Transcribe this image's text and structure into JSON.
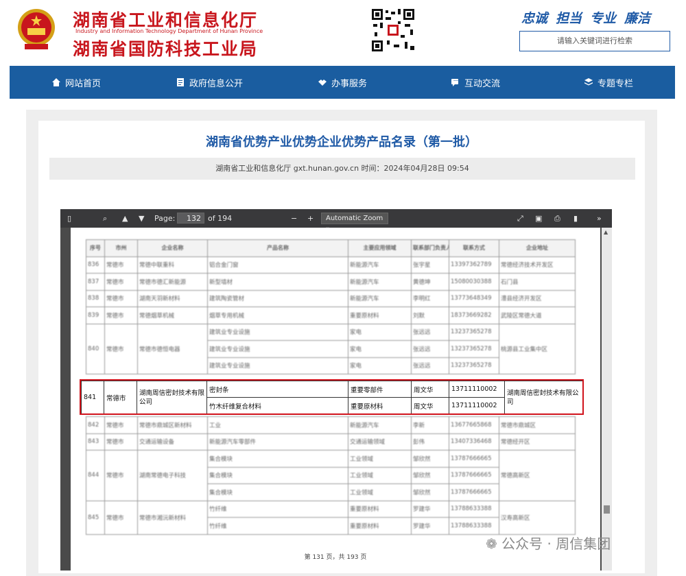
{
  "header": {
    "title_line1": "湖南省工业和信息化厅",
    "title_en": "Industry and Information Technology Department of Hunan Province",
    "title_line2": "湖南省国防科技工业局",
    "slogans": [
      "忠诚",
      "担当",
      "专业",
      "廉洁"
    ],
    "search_placeholder": "请输入关键词进行检索"
  },
  "nav": [
    {
      "label": "网站首页",
      "icon": "home-icon"
    },
    {
      "label": "政府信息公开",
      "icon": "document-icon"
    },
    {
      "label": "办事服务",
      "icon": "handshake-icon"
    },
    {
      "label": "互动交流",
      "icon": "chat-icon"
    },
    {
      "label": "专题专栏",
      "icon": "layers-icon"
    }
  ],
  "article": {
    "title": "湖南省优势产业优势企业优势产品名录（第一批）",
    "meta": "湖南省工业和信息化厅 gxt.hunan.gov.cn   时间：2024年04月28日 09:54"
  },
  "viewer": {
    "page_label": "Page:",
    "page_current": "132",
    "page_total": "of 194",
    "zoom": "Automatic Zoom",
    "page_footer": "第 131 页，共 193 页"
  },
  "table": {
    "headers": [
      "序号",
      "市州",
      "企业名称",
      "产品名称",
      "主要应用领域",
      "联系部门负责人",
      "联系方式",
      "企业地址"
    ],
    "rows_before": [
      {
        "no": "836",
        "city": "常德市",
        "company": "常德中联重科",
        "product": "铝合金门窗",
        "field": "新能源汽车",
        "person": "张宇星",
        "phone": "13397362789",
        "addr": "常德经济技术开发区"
      },
      {
        "no": "837",
        "city": "常德市",
        "company": "常德市德汇新能源",
        "product": "新型墙材",
        "field": "新能源汽车",
        "person": "黄德坤",
        "phone": "15080030388",
        "addr": "石门县"
      },
      {
        "no": "838",
        "city": "常德市",
        "company": "湖南天羽新材料",
        "product": "建筑陶瓷管材",
        "field": "新能源汽车",
        "person": "李明红",
        "phone": "13773648349",
        "addr": "澧县经济开发区"
      },
      {
        "no": "839",
        "city": "常德市",
        "company": "常德烟草机械",
        "product": "烟草专用机械",
        "field": "重要原材料",
        "person": "刘默",
        "phone": "18373669282",
        "addr": "武陵区常德大道"
      },
      {
        "no": "840",
        "city": "常德市",
        "company": "常德市德恒电器",
        "product": "建筑业专业设施",
        "field": "家电",
        "person": "张远远",
        "phone": "13237365278",
        "addr": "桃源县工业集中区"
      }
    ],
    "highlight": [
      {
        "no": "841",
        "city": "常德市",
        "company": "湖南周信密封技术有限公司",
        "product": "密封条",
        "field": "重要零部件",
        "person": "周文华",
        "phone": "13711110002",
        "addr": "湖南周信密封技术有限公司"
      },
      {
        "product": "竹木纤维复合材料",
        "field": "重要原材料",
        "person": "周文华",
        "phone": "13711110002"
      }
    ],
    "rows_after": [
      {
        "no": "842",
        "city": "常德市",
        "company": "常德市鼎城区新材料",
        "product": "工业",
        "field": "新能源汽车",
        "person": "李新",
        "phone": "13677665868",
        "addr": "常德市鼎城区"
      },
      {
        "no": "843",
        "city": "常德市",
        "company": "交通运输设备",
        "product": "新能源汽车零部件",
        "field": "交通运输领域",
        "person": "彭伟",
        "phone": "13407336468",
        "addr": "常德经开区"
      },
      {
        "no": "844",
        "city": "常德市",
        "company": "湖南常德电子科技",
        "product": "集合模块",
        "field": "工业领域",
        "person": "邹欣然",
        "phone": "13787666665",
        "addr": "常德高新区"
      },
      {
        "no": "845",
        "city": "常德市",
        "company": "常德市湘沅新材料",
        "product": "竹纤维",
        "field": "重要原材料",
        "person": "罗建华",
        "phone": "13788633388",
        "addr": "汉寿高新区"
      }
    ]
  },
  "watermark": "公众号 · 周信集团"
}
